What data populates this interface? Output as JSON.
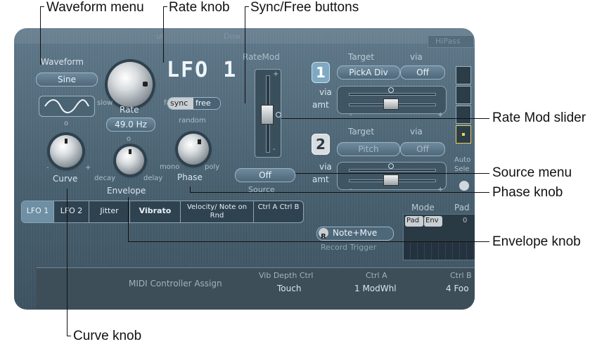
{
  "callouts": {
    "waveform_menu": "Waveform menu",
    "rate_knob": "Rate knob",
    "sync_free_buttons": "Sync/Free buttons",
    "rate_mod_slider": "Rate Mod slider",
    "source_menu": "Source menu",
    "phase_knob": "Phase knob",
    "envelope_knob": "Envelope knob",
    "curve_knob": "Curve knob"
  },
  "top_strip": {
    "left": "ui",
    "mid": "Dow",
    "right": "HiPass"
  },
  "lfo": {
    "title": "LFO 1",
    "waveform_label": "Waveform",
    "waveform_value": "Sine",
    "rate_slow": "slow",
    "rate_fast": "fast",
    "rate_label": "Rate",
    "rate_value": "49.0 Hz",
    "sync_label": "sync",
    "free_label": "free",
    "curve_label": "Curve",
    "envelope_label": "Envelope",
    "env_decay": "decay",
    "env_delay": "delay",
    "phase_random": "random",
    "phase_mono": "mono",
    "phase_poly": "poly",
    "phase_label": "Phase",
    "minus": "-",
    "plus": "+"
  },
  "ratemod": {
    "label": "RateMod",
    "source_value": "Off",
    "source_label": "Source"
  },
  "mod_routes": [
    {
      "num": "1",
      "target_label": "Target",
      "via_label": "via",
      "target_value": "PickA Div",
      "via_value": "Off",
      "row_via": "via",
      "row_amt": "amt"
    },
    {
      "num": "2",
      "target_label": "Target",
      "via_label": "via",
      "target_value": "Pitch",
      "via_value": "Off",
      "row_via": "via",
      "row_amt": "amt"
    }
  ],
  "tabs": [
    "LFO 1",
    "LFO 2",
    "Jitter",
    "Vibrato",
    "Velocity/ Note on Rnd",
    "Ctrl A Ctrl B"
  ],
  "mode": {
    "label": "Mode",
    "pad_header": "Pad",
    "btn_pad": "Pad",
    "btn_env": "Env",
    "value": "0"
  },
  "record": {
    "r_icon": "R",
    "mode_value": "Note+Mve",
    "label": "Record Trigger"
  },
  "midi": {
    "title": "MIDI Controller Assign",
    "columns": [
      {
        "header": "Vib Depth Ctrl",
        "value": "Touch"
      },
      {
        "header": "Ctrl A",
        "value": "1 ModWhl"
      },
      {
        "header": "Ctrl B",
        "value": "4 Foo"
      }
    ]
  },
  "side": {
    "auto": "Auto",
    "sel": "Sele"
  }
}
